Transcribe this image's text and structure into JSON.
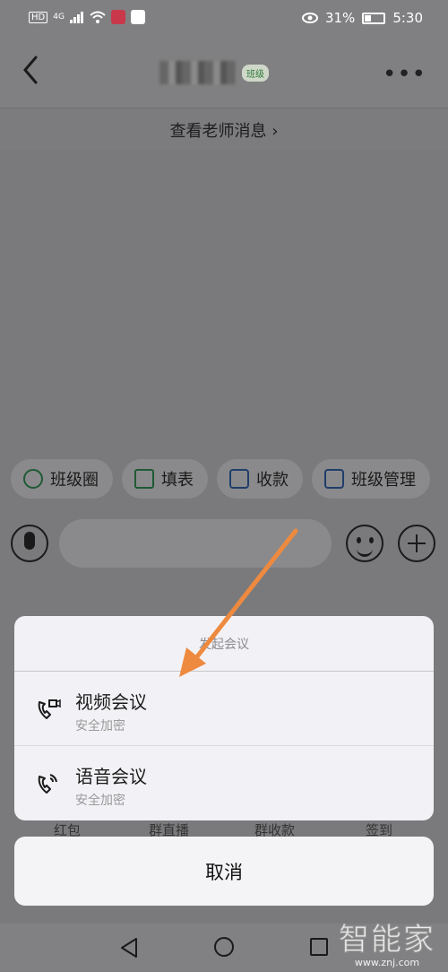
{
  "status_bar": {
    "left_icons": [
      "hd-icon",
      "4g-signal-icon",
      "wifi-icon",
      "app-notification-icon",
      "app-notification-icon"
    ],
    "left_text": "HD",
    "network": "4G",
    "battery": "31%",
    "time": "5:30"
  },
  "header": {
    "badge": "班级"
  },
  "teacher_message": {
    "label": "查看老师消息 ›"
  },
  "quick_actions": [
    {
      "label": "班级圈",
      "icon": "class-circle-icon"
    },
    {
      "label": "填表",
      "icon": "form-icon"
    },
    {
      "label": "收款",
      "icon": "payment-icon"
    },
    {
      "label": "班级管理",
      "icon": "class-manage-icon"
    }
  ],
  "bottom_grid_labels": [
    "红包",
    "群直播",
    "群收款",
    "签到"
  ],
  "sheet": {
    "title": "发起会议",
    "items": [
      {
        "label": "视频会议",
        "sub": "安全加密",
        "icon": "video-call-icon"
      },
      {
        "label": "语音会议",
        "sub": "安全加密",
        "icon": "voice-call-icon"
      }
    ]
  },
  "cancel_label": "取消",
  "watermark": {
    "main": "智能家",
    "sub": "www.znj.com"
  },
  "colors": {
    "overlay_bg": "#7a7a7c",
    "sheet_bg": "#f2f2f6",
    "arrow": "#ee8a3f",
    "accent_green": "#1f5a34"
  }
}
